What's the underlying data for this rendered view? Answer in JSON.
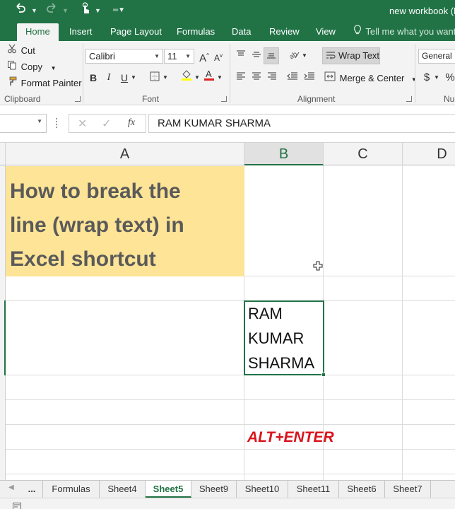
{
  "window": {
    "title": "new workbook (R"
  },
  "tabs": [
    "Home",
    "Insert",
    "Page Layout",
    "Formulas",
    "Data",
    "Review",
    "View"
  ],
  "tell_me": "Tell me what you want t",
  "clipboard": {
    "cut": "Cut",
    "copy": "Copy",
    "format_painter": "Format Painter",
    "label": "Clipboard"
  },
  "font": {
    "name": "Calibri",
    "size": "11",
    "label": "Font"
  },
  "alignment": {
    "wrap_text": "Wrap Text",
    "merge_center": "Merge & Center",
    "label": "Alignment"
  },
  "number": {
    "format": "General",
    "label": "Nu",
    "currency_symbol": "$",
    "percent_symbol": "%"
  },
  "formula_bar": {
    "fx": "fx",
    "value": "RAM KUMAR SHARMA"
  },
  "columns": [
    "A",
    "B",
    "C",
    "D"
  ],
  "cells": {
    "title_lines": [
      "How to break the",
      "line (wrap text) in",
      "Excel shortcut"
    ],
    "name_lines": [
      "RAM",
      "KUMAR",
      "SHARMA"
    ],
    "shortcut": "ALT+ENTER"
  },
  "sheets": [
    "...",
    "Formulas",
    "Sheet4",
    "Sheet5",
    "Sheet9",
    "Sheet10",
    "Sheet11",
    "Sheet6",
    "Sheet7"
  ],
  "active_sheet": "Sheet5",
  "colors": {
    "excel_green": "#217346",
    "title_fill": "#fde496",
    "shortcut_red": "#d9141c"
  }
}
